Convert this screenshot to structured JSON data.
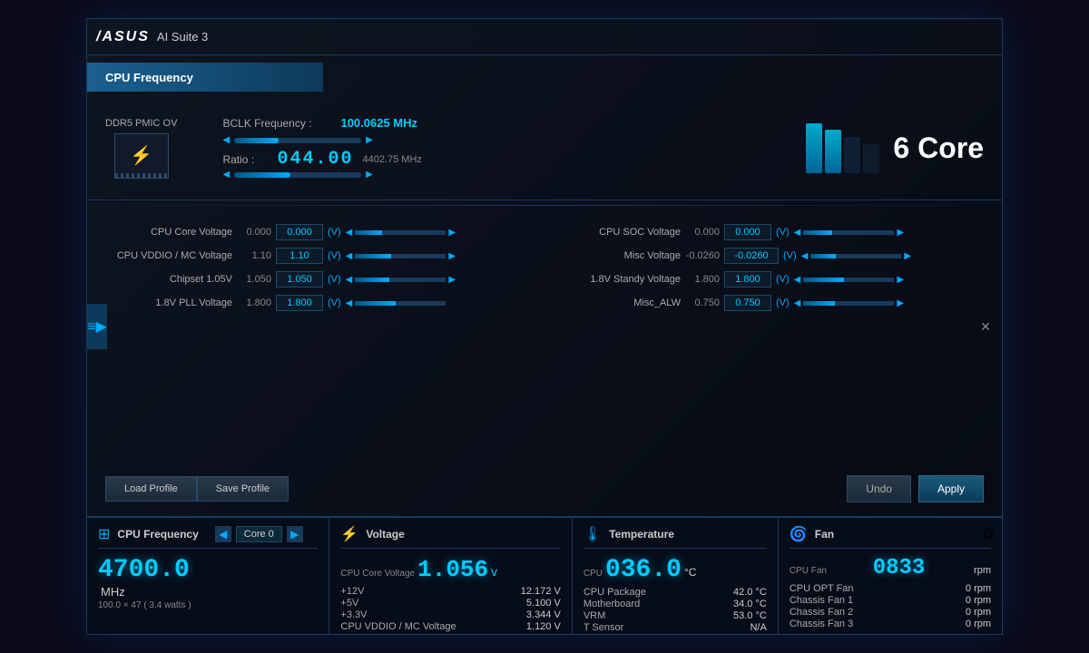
{
  "app": {
    "title": "AI Suite 3",
    "logo": "/ASUS",
    "section": "CPU Frequency"
  },
  "top": {
    "ddr5_label": "DDR5 PMIC OV",
    "bclk_label": "BCLK Frequency :",
    "bclk_value": "100.0625 MHz",
    "ratio_label": "Ratio :",
    "ratio_value": "044.00",
    "ratio_freq": "4402.75 MHz",
    "core_count": "6 Core"
  },
  "voltages_left": [
    {
      "label": "CPU Core Voltage",
      "val": "0.000",
      "input": "0.000",
      "unit": "(V)"
    },
    {
      "label": "CPU VDDIO / MC Voltage",
      "val": "1.10",
      "input": "1.10",
      "unit": "(V)"
    },
    {
      "label": "Chipset 1.05V",
      "val": "1.050",
      "input": "1.050",
      "unit": "(V)"
    },
    {
      "label": "1.8V PLL Voltage",
      "val": "1.800",
      "input": "1.800",
      "unit": "(V)"
    }
  ],
  "voltages_right": [
    {
      "label": "CPU SOC Voltage",
      "val": "0.000",
      "input": "0.000",
      "unit": "(V)"
    },
    {
      "label": "Misc Voltage",
      "val": "-0.0260",
      "input": "-0.0260",
      "unit": "(V)"
    },
    {
      "label": "1.8V Standy Voltage",
      "val": "1.800",
      "input": "1.800",
      "unit": "(V)"
    },
    {
      "label": "Misc_ALW",
      "val": "0.750",
      "input": "0.750",
      "unit": "(V)"
    }
  ],
  "buttons": {
    "undo": "Undo",
    "apply": "Apply",
    "load_profile": "Load Profile",
    "save_profile": "Save Profile"
  },
  "status": {
    "cpu_freq": {
      "title": "CPU Frequency",
      "core_label": "Core 0",
      "value": "4700.0",
      "unit": "MHz",
      "detail": "100.0 × 47   ( 3.4  watts )"
    },
    "voltage": {
      "title": "Voltage",
      "cpu_core_label": "CPU Core Voltage",
      "cpu_core_value": "1.056",
      "unit": "v",
      "rows": [
        {
          "name": "+12V",
          "value": "12.172 V"
        },
        {
          "name": "+5V",
          "value": "5.100 V"
        },
        {
          "name": "+3.3V",
          "value": "3.344 V"
        },
        {
          "name": "CPU VDDIO / MC Voltage",
          "value": "1.120 V"
        }
      ]
    },
    "temperature": {
      "title": "Temperature",
      "cpu_label": "CPU",
      "cpu_value": "036.0",
      "unit": "°C",
      "rows": [
        {
          "name": "CPU Package",
          "value": "42.0 °C"
        },
        {
          "name": "Motherboard",
          "value": "34.0 °C"
        },
        {
          "name": "VRM",
          "value": "53.0 °C"
        },
        {
          "name": "T Sensor",
          "value": "N/A"
        }
      ]
    },
    "fan": {
      "title": "Fan",
      "cpu_fan_label": "CPU Fan",
      "cpu_fan_value": "0833",
      "unit": "rpm",
      "rows": [
        {
          "name": "CPU OPT Fan",
          "value": "0 rpm"
        },
        {
          "name": "Chassis Fan 1",
          "value": "0 rpm"
        },
        {
          "name": "Chassis Fan 2",
          "value": "0 rpm"
        },
        {
          "name": "Chassis Fan 3",
          "value": "0 rpm"
        }
      ]
    }
  }
}
